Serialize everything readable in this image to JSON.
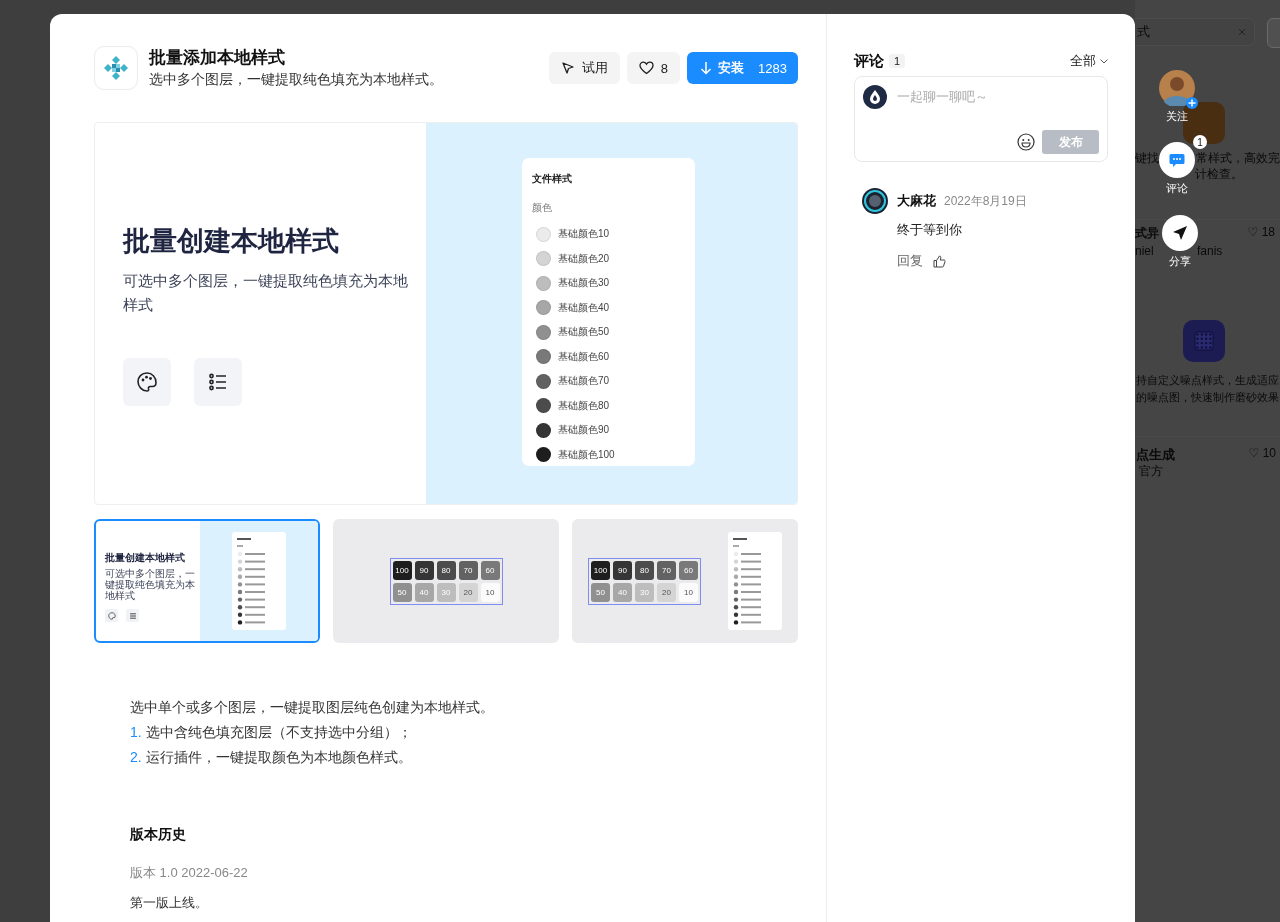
{
  "plugin": {
    "title": "批量添加本地样式",
    "subtitle": "选中多个图层，一键提取纯色填充为本地样式。",
    "try_label": "试用",
    "likes": "8",
    "install_label": "安装",
    "installs": "1283"
  },
  "preview": {
    "title": "批量创建本地样式",
    "subtitle": "可选中多个图层，一键提取纯色填充为本地样式",
    "panel_title": "文件样式",
    "group": "颜色",
    "styles": [
      "基础颜色10",
      "基础颜色20",
      "基础颜色30",
      "基础颜色40",
      "基础颜色50",
      "基础颜色60",
      "基础颜色70",
      "基础颜色80",
      "基础颜色90",
      "基础颜色100"
    ]
  },
  "thumbnails": [
    {
      "kind": "cover",
      "selected": true,
      "title": "批量创建本地样式",
      "subtitle": "可选中多个图层，一键提取纯色填充为本地样式"
    },
    {
      "kind": "swatches",
      "selected": false,
      "tiles": [
        "100",
        "90",
        "80",
        "70",
        "60",
        "50",
        "40",
        "30",
        "20",
        "10"
      ]
    },
    {
      "kind": "swatches_panel",
      "selected": false,
      "tiles": [
        "100",
        "90",
        "80",
        "70",
        "60",
        "50",
        "40",
        "30",
        "20",
        "10"
      ]
    }
  ],
  "description": {
    "intro": "选中单个或多个图层，一键提取图层纯色创建为本地样式。",
    "steps": [
      {
        "number": "1.",
        "text": "选中含纯色填充图层（不支持选中分组）；"
      },
      {
        "number": "2.",
        "text": "运行插件，一键提取颜色为本地颜色样式。"
      }
    ]
  },
  "history": {
    "heading": "版本历史",
    "version": "版本 1.0  2022-06-22",
    "note": "第一版上线。"
  },
  "comments": {
    "title": "评论",
    "count": "1",
    "filter": "全部",
    "placeholder": "一起聊一聊吧～",
    "submit_label": "发布",
    "submit_disabled": true,
    "items": [
      {
        "author": "大麻花",
        "date": "2022年8月19日",
        "text": "终于等到你",
        "reply_label": "回复"
      }
    ]
  },
  "actions": [
    {
      "kind": "follow",
      "label": "关注"
    },
    {
      "kind": "comment",
      "label": "评论",
      "badge": "1"
    },
    {
      "kind": "share",
      "label": "分享"
    }
  ],
  "background": {
    "search_value": "式",
    "desc_1a": "键找",
    "desc_1b": "常样式，高效完",
    "desc_2": "计检查。",
    "card_2_title": "式异",
    "card_2_likes": "♡ 18",
    "card_2_author": "niel",
    "card_2_author_tail": "fanis",
    "desc_3": "持自定义噪点样式，生成适应",
    "desc_4": "的噪点图，快速制作磨砂效果",
    "card_3_title": "点生成",
    "card_3_likes": "♡ 10",
    "card_3_author": "官方"
  }
}
